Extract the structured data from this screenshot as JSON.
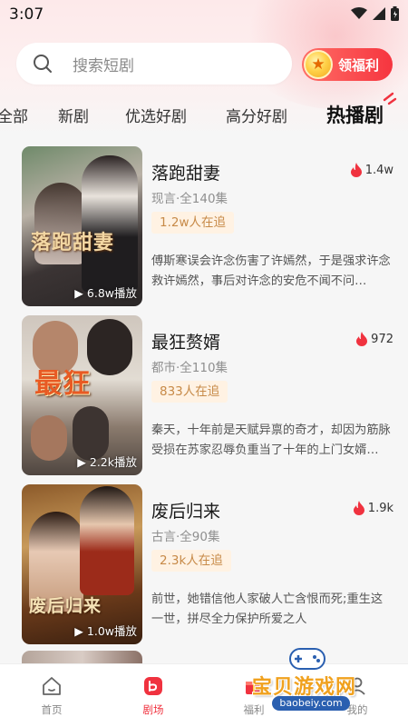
{
  "status": {
    "time": "3:07"
  },
  "search": {
    "placeholder": "搜索短剧"
  },
  "welfare": {
    "label": "领福利",
    "icon": "coin-icon"
  },
  "tabs": [
    {
      "label": "全部"
    },
    {
      "label": "新剧"
    },
    {
      "label": "优选好剧"
    },
    {
      "label": "高分好剧"
    },
    {
      "label": "热播剧",
      "active": true
    }
  ],
  "items": [
    {
      "title": "落跑甜妻",
      "hot": "1.4w",
      "meta": "现言·全140集",
      "badge": "1.2w人在追",
      "desc": "傅斯寒误会许念伤害了许嫣然，于是强求许念救许嫣然，事后对许念的安危不闻不问…",
      "plays": "6.8w播放",
      "cover_text": "落跑甜妻"
    },
    {
      "title": "最狂赘婿",
      "hot": "972",
      "meta": "都市·全110集",
      "badge": "833人在追",
      "desc": "秦天，十年前是天赋异禀的奇才，却因为筋脉受损在苏家忍辱负重当了十年的上门女婿…",
      "plays": "2.2k播放",
      "cover_text": "最狂"
    },
    {
      "title": "废后归来",
      "hot": "1.9k",
      "meta": "古言·全90集",
      "badge": "2.3k人在追",
      "desc": "前世，她错信他人家破人亡含恨而死;重生这一世，拼尽全力保护所爱之人",
      "plays": "1.0w播放",
      "cover_text": "废后归来"
    }
  ],
  "nav": [
    {
      "label": "首页",
      "icon": "home-icon"
    },
    {
      "label": "剧场",
      "icon": "theater-icon",
      "active": true
    },
    {
      "label": "福利",
      "icon": "gift-icon"
    },
    {
      "label": "我的",
      "icon": "profile-icon"
    }
  ],
  "watermark": {
    "text": "宝贝游戏网",
    "url": "baobeiy.com"
  },
  "colors": {
    "accent": "#f0323f",
    "badge_bg": "#fff2e3",
    "badge_text": "#c78a48"
  }
}
